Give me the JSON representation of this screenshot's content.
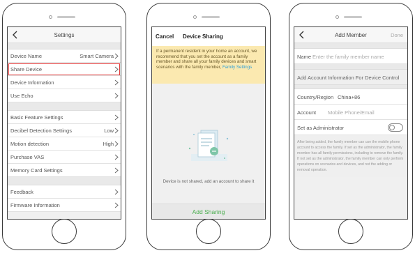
{
  "settings": {
    "title": "Settings",
    "rows": [
      {
        "label": "Device Name",
        "value": "Smart Camera"
      },
      {
        "label": "Share Device",
        "value": ""
      },
      {
        "label": "Device Information",
        "value": ""
      },
      {
        "label": "Use Echo",
        "value": ""
      },
      {
        "label": "Basic Feature Settings",
        "value": ""
      },
      {
        "label": "Decibel Detection Settings",
        "value": "Low"
      },
      {
        "label": "Motion detection",
        "value": "High"
      },
      {
        "label": "Purchase VAS",
        "value": ""
      },
      {
        "label": "Memory Card Settings",
        "value": ""
      },
      {
        "label": "Feedback",
        "value": ""
      },
      {
        "label": "Firmware Information",
        "value": ""
      }
    ]
  },
  "sharing": {
    "cancel": "Cancel",
    "title": "Device Sharing",
    "notice": "If a permanent resident in your home an account, we recommend that you set the account as a family member and share all your family devices and smart scenarios with the family member,",
    "notice_link": "Family Settings",
    "empty_text": "Device is not shared, add an account to share it",
    "add_button": "Add Sharing"
  },
  "add_member": {
    "title": "Add Member",
    "done": "Done",
    "name_label": "Name",
    "name_placeholder": "Enter the family member name",
    "section_title": "Add Account Information For Device Control",
    "country_label": "Country/Region",
    "country_value": "China+86",
    "account_label": "Account",
    "account_placeholder": "Mobile Phone/Email",
    "admin_label": "Set as Administrator",
    "admin_enabled": false,
    "note": "After being added, the family member can use the mobile phone account to access the family. If set as the administrator, the family member has all family permissions, including to remove the family. If not set as the administrator, the family member can only perform operations on scenarios and devices, and not the adding or removal operation."
  },
  "colors": {
    "highlight": "#e13a3a",
    "accent_green": "#4aae4e",
    "link_blue": "#2f9fd6",
    "notice_bg": "#fbe9b0"
  }
}
